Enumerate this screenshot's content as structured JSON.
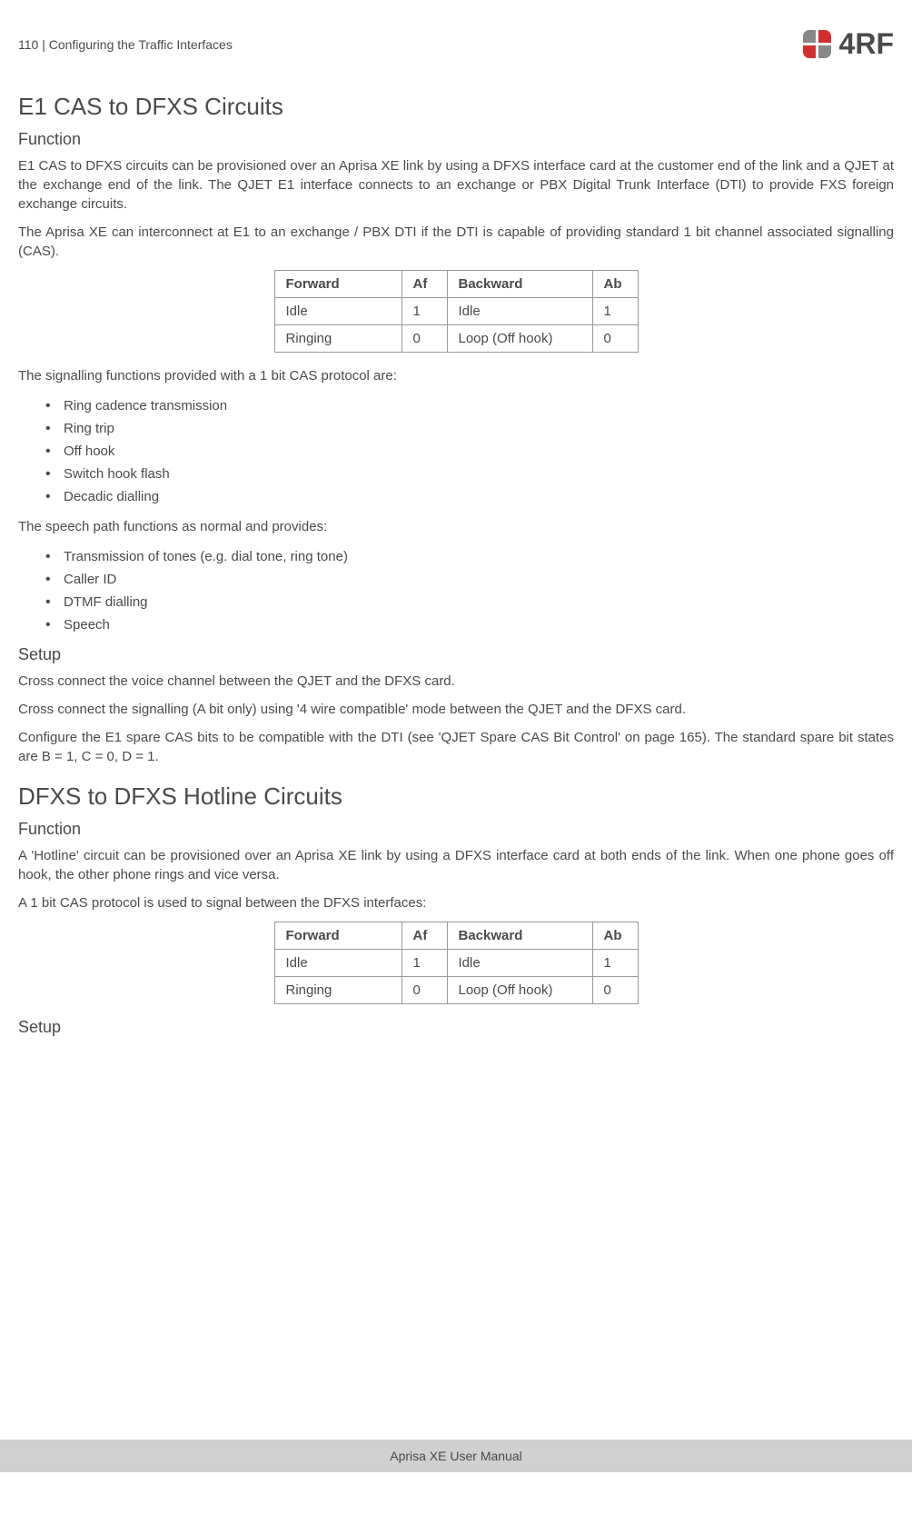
{
  "header": {
    "page_number": "110",
    "section": "Configuring the Traffic Interfaces",
    "logo_text": "4RF"
  },
  "section1": {
    "title": "E1 CAS to DFXS Circuits",
    "function_heading": "Function",
    "para1": "E1 CAS to DFXS circuits can be provisioned over an Aprisa XE link by using a DFXS interface card at the customer end of the link and a QJET at the exchange end of the link. The QJET E1 interface connects to an exchange or PBX Digital Trunk Interface (DTI) to provide FXS foreign exchange circuits.",
    "para2": "The Aprisa XE can interconnect at E1 to an exchange / PBX DTI if the DTI is capable of providing standard 1 bit channel associated signalling (CAS).",
    "table1": {
      "headers": {
        "forward": "Forward",
        "af": "Af",
        "backward": "Backward",
        "ab": "Ab"
      },
      "rows": [
        {
          "forward": "Idle",
          "af": "1",
          "backward": "Idle",
          "ab": "1"
        },
        {
          "forward": "Ringing",
          "af": "0",
          "backward": "Loop (Off hook)",
          "ab": "0"
        }
      ]
    },
    "para3": "The signalling functions provided with a 1 bit CAS protocol are:",
    "list1": [
      "Ring cadence transmission",
      "Ring trip",
      "Off hook",
      "Switch hook flash",
      "Decadic dialling"
    ],
    "para4": "The speech path functions as normal and provides:",
    "list2": [
      "Transmission of tones (e.g. dial tone, ring tone)",
      "Caller ID",
      "DTMF dialling",
      "Speech"
    ],
    "setup_heading": "Setup",
    "setup_para1": "Cross connect the voice channel between the QJET and the DFXS card.",
    "setup_para2": "Cross connect the signalling (A bit only) using '4 wire compatible' mode between the QJET and the DFXS card.",
    "setup_para3": "Configure the E1 spare CAS bits to be compatible with the DTI (see 'QJET Spare CAS Bit Control' on page 165). The standard spare bit states are B = 1, C = 0, D = 1."
  },
  "section2": {
    "title": "DFXS to DFXS Hotline Circuits",
    "function_heading": "Function",
    "para1": "A 'Hotline' circuit can be provisioned over an Aprisa XE link by using a DFXS interface card at both ends of the link. When one phone goes off hook, the other phone rings and vice versa.",
    "para2": "A 1 bit CAS protocol is used to signal between the DFXS interfaces:",
    "table2": {
      "headers": {
        "forward": "Forward",
        "af": "Af",
        "backward": "Backward",
        "ab": "Ab"
      },
      "rows": [
        {
          "forward": "Idle",
          "af": "1",
          "backward": "Idle",
          "ab": "1"
        },
        {
          "forward": "Ringing",
          "af": "0",
          "backward": "Loop (Off hook)",
          "ab": "0"
        }
      ]
    },
    "setup_heading": "Setup"
  },
  "footer": {
    "text": "Aprisa XE User Manual"
  }
}
